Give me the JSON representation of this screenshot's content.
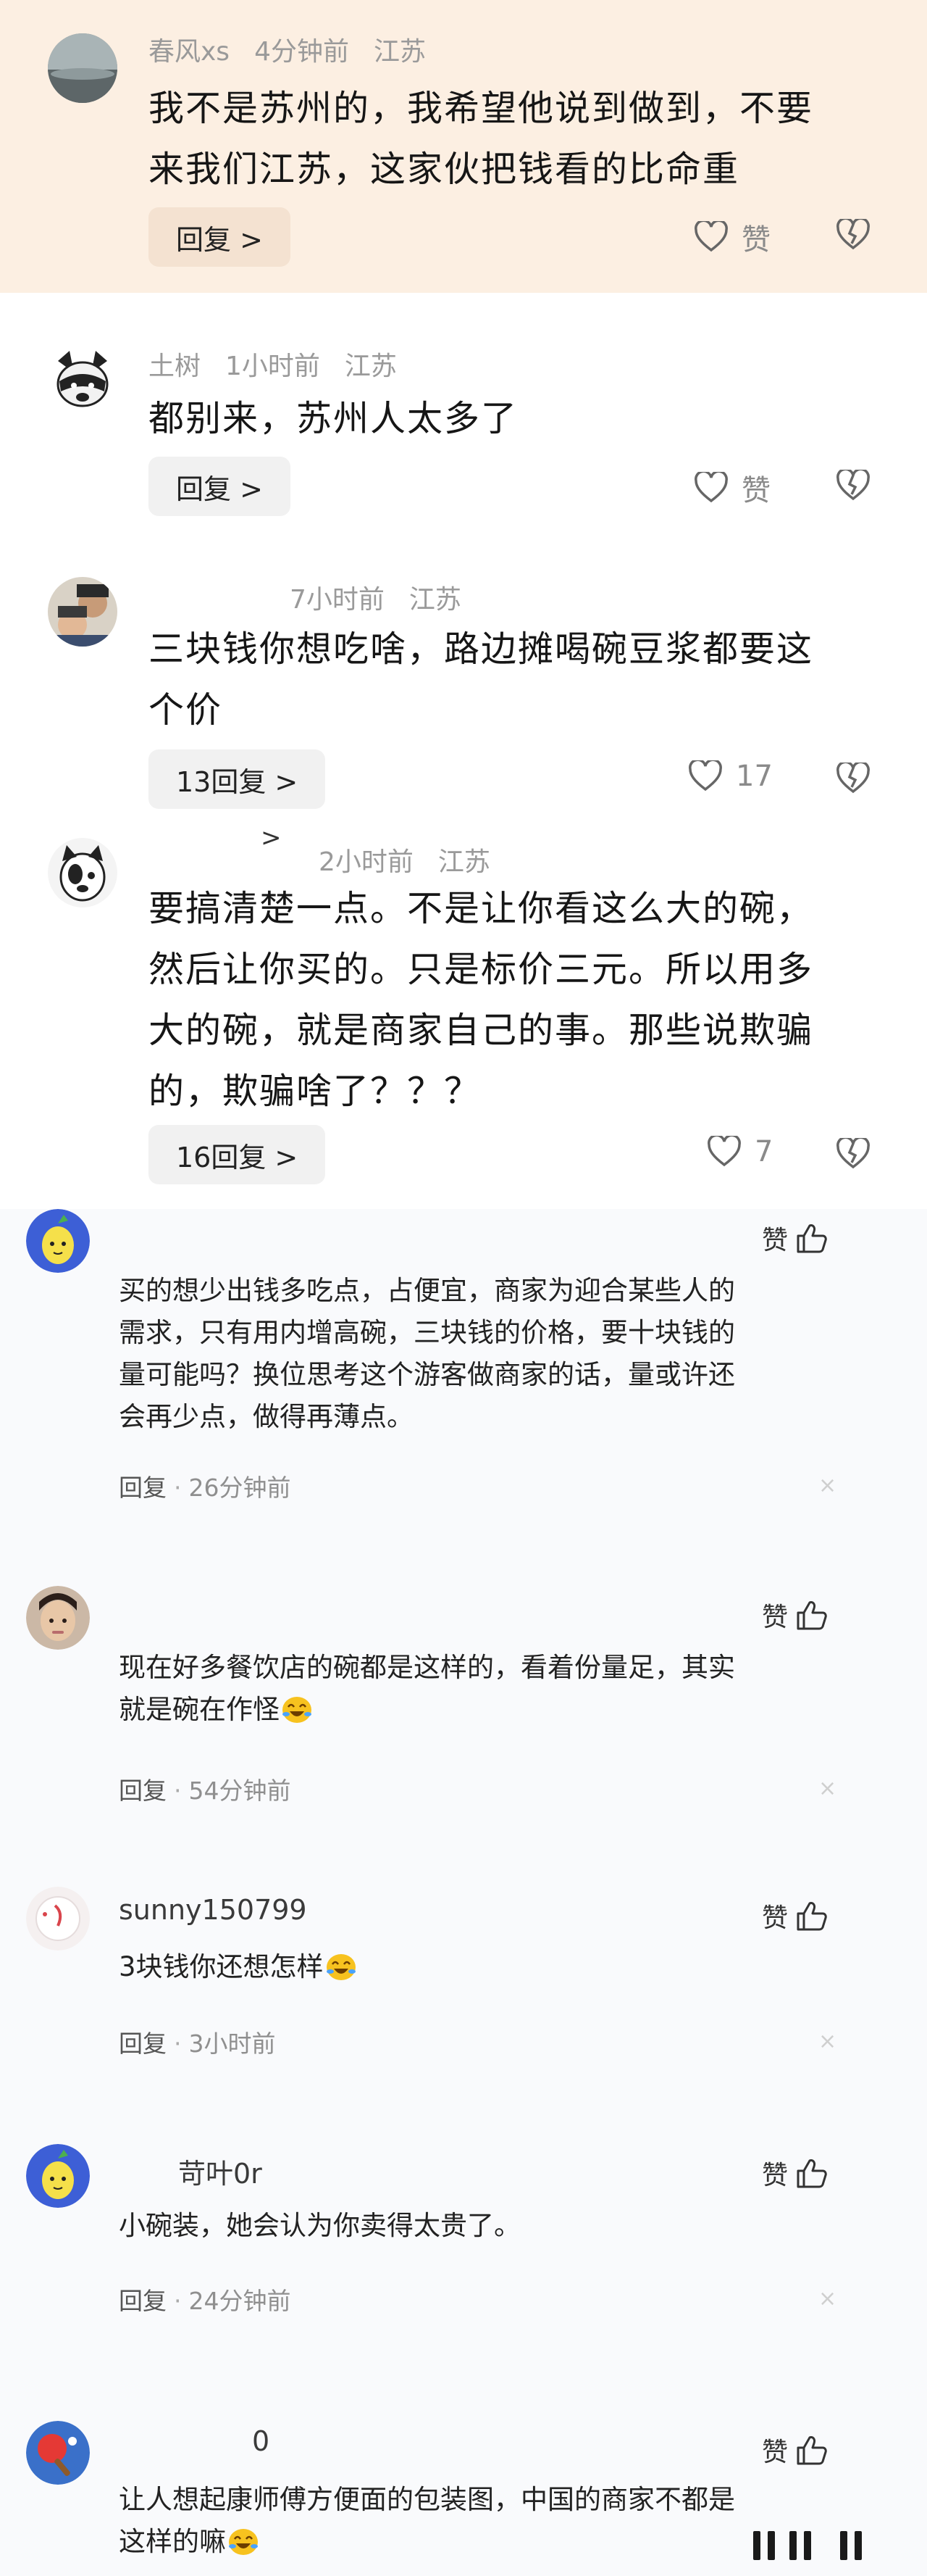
{
  "sectionA": {
    "comments": [
      {
        "username": "春风xs",
        "time": "4分钟前",
        "location": "江苏",
        "text_lines": [
          "我不是苏州的，我希望他说到做到，不要",
          "来我们江苏，这家伙把钱看的比命重"
        ],
        "reply_label": "回复 >",
        "like_label": "赞"
      },
      {
        "username": "土树",
        "time": "1小时前",
        "location": "江苏",
        "text_lines": [
          "都别来，苏州人太多了"
        ],
        "reply_label": "回复 >",
        "like_label": "赞"
      },
      {
        "username": "",
        "time": "7小时前",
        "location": "江苏",
        "text_lines": [
          "三块钱你想吃啥，路边摊喝碗豆浆都要这",
          "个价"
        ],
        "reply_label": "13回复 >",
        "like_label": "17"
      },
      {
        "username": "",
        "time": "2小时前",
        "location": "江苏",
        "text_lines": [
          "要搞清楚一点。不是让你看这么大的碗，",
          "然后让你买的。只是标价三元。所以用多",
          "大的碗，就是商家自己的事。那些说欺骗",
          "的，欺骗啥了？？？"
        ],
        "reply_label": "16回复 >",
        "like_label": "7"
      }
    ],
    "stray_chevron": ">"
  },
  "sectionB": {
    "comments": [
      {
        "username": "",
        "text_lines": [
          "买的想少出钱多吃点，占便宜，商家为迎合某些人的",
          "需求，只有用内增高碗，三块钱的价格，要十块钱的",
          "量可能吗？换位思考这个游客做商家的话，量或许还",
          "会再少点，做得再薄点。"
        ],
        "reply_label": "回复",
        "time": "26分钟前",
        "zan_label": "赞",
        "close_label": "×"
      },
      {
        "username": "",
        "text_lines": [
          "现在好多餐饮店的碗都是这样的，看着份量足，其实",
          "就是碗在作怪"
        ],
        "reply_label": "回复",
        "time": "54分钟前",
        "zan_label": "赞",
        "close_label": "×"
      },
      {
        "username": "sunny150799",
        "text_lines": [
          "3块钱你还想怎样"
        ],
        "reply_label": "回复",
        "time": "3小时前",
        "zan_label": "赞",
        "close_label": "×"
      },
      {
        "username": "苛叶0r",
        "text_lines": [
          "小碗装，她会认为你卖得太贵了。"
        ],
        "reply_label": "回复",
        "time": "24分钟前",
        "zan_label": "赞",
        "close_label": "×"
      },
      {
        "username": "0",
        "text_lines": [
          "让人想起康师傅方便面的包装图，中国的商家不都是",
          "这样的嘛"
        ],
        "reply_label": "",
        "time": "",
        "zan_label": "赞",
        "close_label": ""
      }
    ]
  },
  "colors": {
    "highlight_bg": "#fcefe2",
    "sectionB_bg": "#f9fafc",
    "meta_gray": "#9a9a9a"
  }
}
